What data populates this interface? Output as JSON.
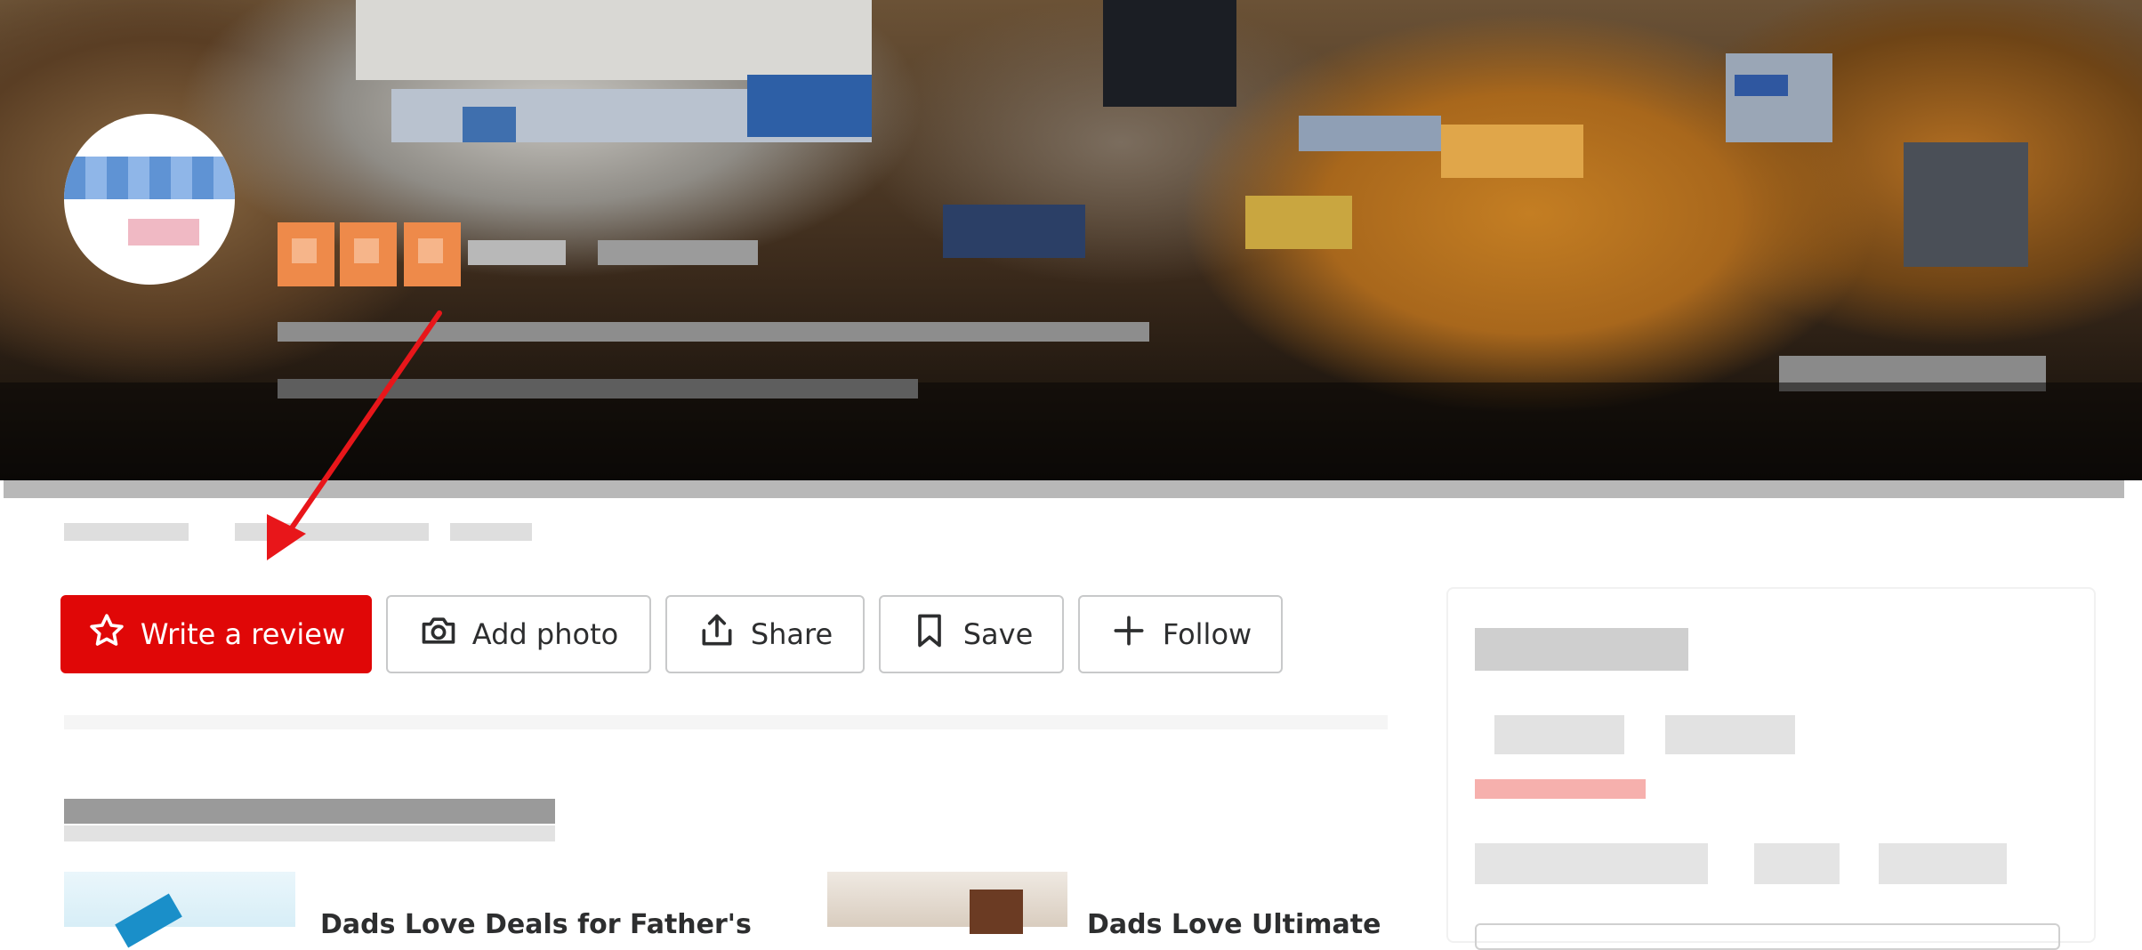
{
  "actions": {
    "write_review": "Write a review",
    "add_photo": "Add photo",
    "share": "Share",
    "save": "Save",
    "follow": "Follow"
  },
  "icons": {
    "write_review": "star-outline-icon",
    "add_photo": "camera-icon",
    "share": "share-icon",
    "save": "bookmark-icon",
    "follow": "plus-icon"
  },
  "deals": [
    {
      "title": "Dads Love Deals for Father's"
    },
    {
      "title": "Dads Love Ultimate"
    }
  ],
  "colors": {
    "primary_red": "#e00707",
    "annotation_arrow": "#e8161a",
    "rating_orange": "#ee8a4a",
    "text_dark": "#2d2e2f",
    "button_border": "#c8c9ca"
  }
}
